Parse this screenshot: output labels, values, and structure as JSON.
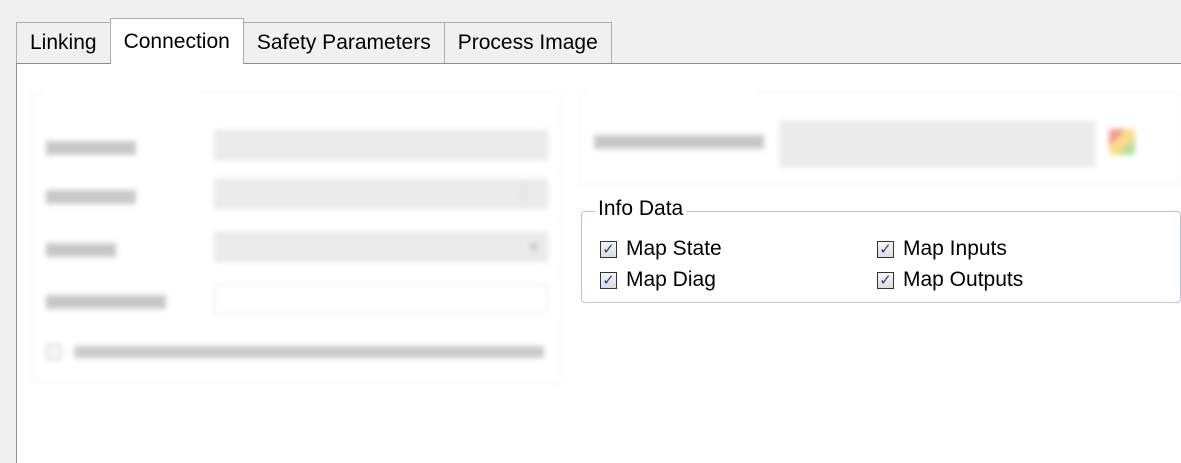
{
  "tabs": [
    {
      "label": "Linking",
      "active": false
    },
    {
      "label": "Connection",
      "active": true
    },
    {
      "label": "Safety Parameters",
      "active": false
    },
    {
      "label": "Process Image",
      "active": false
    }
  ],
  "info_data": {
    "title": "Info Data",
    "checkboxes": [
      {
        "label": "Map State",
        "checked": true
      },
      {
        "label": "Map Inputs",
        "checked": true
      },
      {
        "label": "Map Diag",
        "checked": true
      },
      {
        "label": "Map Outputs",
        "checked": true
      }
    ]
  },
  "colors": {
    "tick": "#1f3fa8",
    "group_border": "#b8c4d3"
  }
}
